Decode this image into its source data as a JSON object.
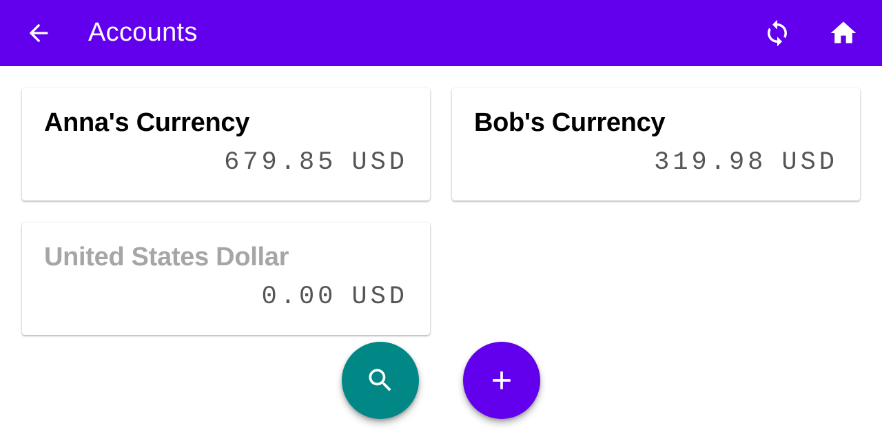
{
  "app_bar": {
    "title": "Accounts",
    "back_icon": "arrow-back-icon",
    "actions": [
      {
        "icon": "sync-icon"
      },
      {
        "icon": "home-icon"
      }
    ],
    "background": "#6200ee"
  },
  "accounts": [
    {
      "name": "Anna's Currency",
      "amount": "679.85",
      "currency": "USD",
      "enabled": true
    },
    {
      "name": "Bob's Currency",
      "amount": "319.98",
      "currency": "USD",
      "enabled": true
    },
    {
      "name": "United States Dollar",
      "amount": "0.00",
      "currency": "USD",
      "enabled": false
    }
  ],
  "fabs": [
    {
      "icon": "search-icon",
      "color": "#018786"
    },
    {
      "icon": "plus-icon",
      "color": "#6200ee"
    }
  ]
}
